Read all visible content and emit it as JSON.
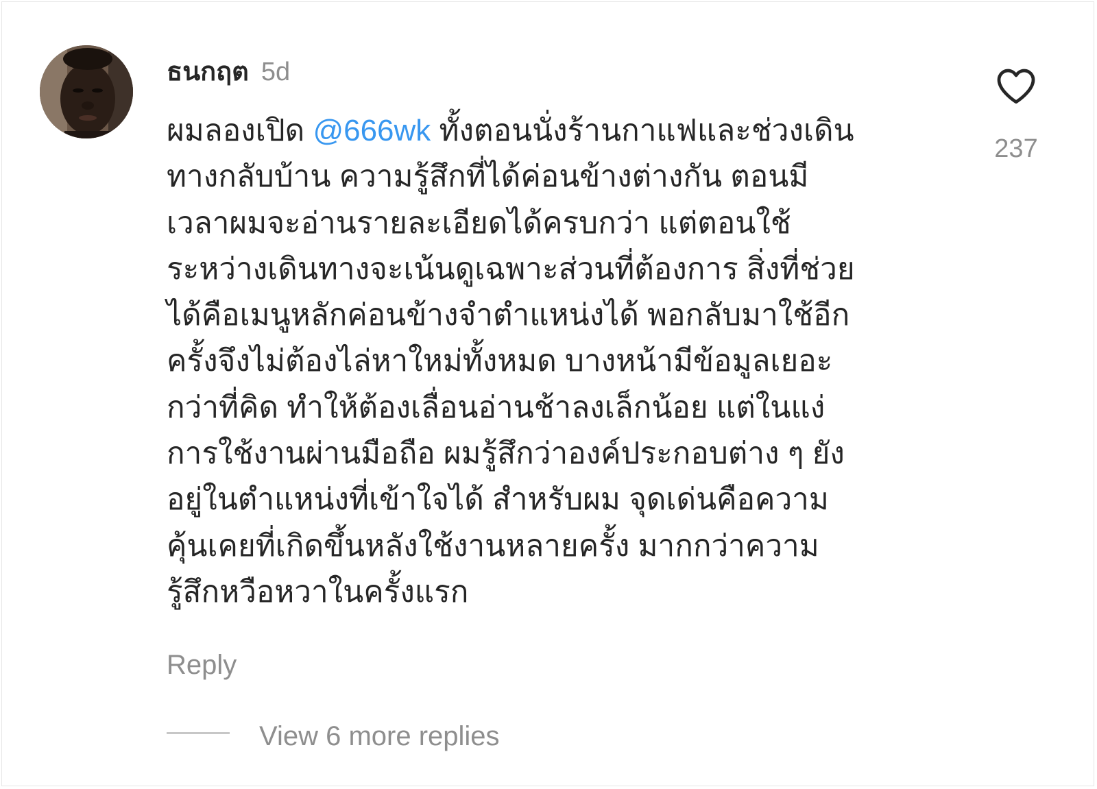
{
  "comment": {
    "author": "ธนกฤต",
    "time_ago": "5d",
    "mention": "@666wk",
    "lines": [
      "ผมลองเปิด ",
      " ทั้งตอนนั่งร้านกาแฟและช่วงเดิน",
      "ทางกลับบ้าน ความรู้สึกที่ได้ค่อนข้างต่างกัน ตอนมี",
      "เวลาผมจะอ่านรายละเอียดได้ครบกว่า แต่ตอนใช้",
      "ระหว่างเดินทางจะเน้นดูเฉพาะส่วนที่ต้องการ สิ่งที่ช่วย",
      "ได้คือเมนูหลักค่อนข้างจำตำแหน่งได้ พอกลับมาใช้อีก",
      "ครั้งจึงไม่ต้องไล่หาใหม่ทั้งหมด บางหน้ามีข้อมูลเยอะ",
      "กว่าที่คิด ทำให้ต้องเลื่อนอ่านช้าลงเล็กน้อย แต่ในแง่",
      "การใช้งานผ่านมือถือ ผมรู้สึกว่าองค์ประกอบต่าง ๆ ยัง",
      "อยู่ในตำแหน่งที่เข้าใจได้ สำหรับผม จุดเด่นคือความ",
      "คุ้นเคยที่เกิดขึ้นหลังใช้งานหลายครั้ง มากกว่าความ",
      "รู้สึกหวือหวาในครั้งแรก"
    ],
    "reply_label": "Reply",
    "like_icon": "heart-outline-icon",
    "like_count": "237",
    "view_replies_label": "View 6 more replies"
  },
  "colors": {
    "text": "#262626",
    "muted": "#8e8e8e",
    "mention": "#3897f0",
    "divider": "#c7c7c7"
  }
}
